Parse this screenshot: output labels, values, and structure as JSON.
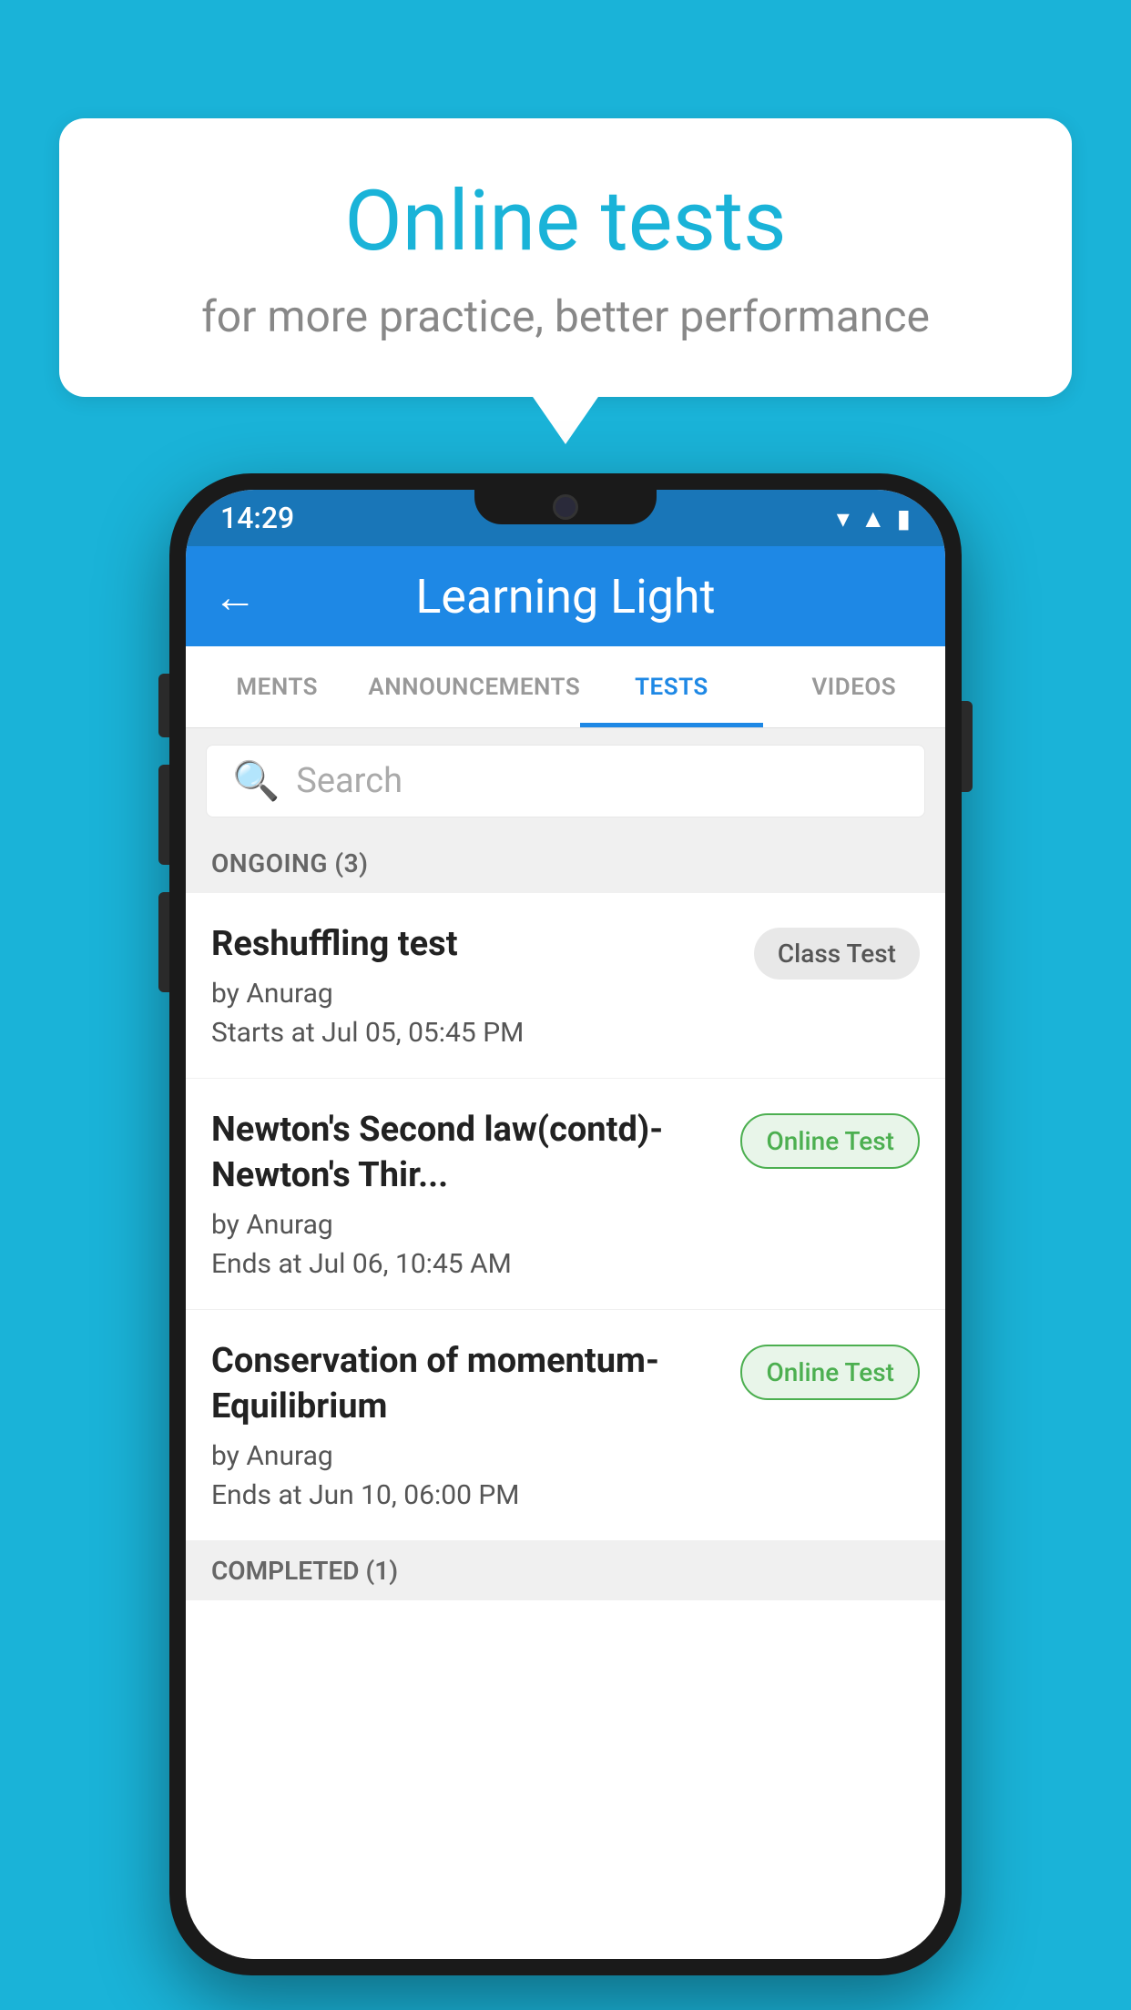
{
  "background_color": "#1ab3d8",
  "speech_bubble": {
    "title": "Online tests",
    "subtitle": "for more practice, better performance"
  },
  "phone": {
    "status_bar": {
      "time": "14:29",
      "icons": [
        "wifi",
        "signal",
        "battery"
      ]
    },
    "app_bar": {
      "title": "Learning Light",
      "back_label": "←"
    },
    "tabs": [
      {
        "label": "MENTS",
        "active": false
      },
      {
        "label": "ANNOUNCEMENTS",
        "active": false
      },
      {
        "label": "TESTS",
        "active": true
      },
      {
        "label": "VIDEOS",
        "active": false
      }
    ],
    "search": {
      "placeholder": "Search"
    },
    "sections": [
      {
        "label": "ONGOING (3)",
        "tests": [
          {
            "name": "Reshuffling test",
            "author": "by Anurag",
            "time_label": "Starts at",
            "time": "Jul 05, 05:45 PM",
            "badge": "Class Test",
            "badge_type": "class"
          },
          {
            "name": "Newton's Second law(contd)-Newton's Thir...",
            "author": "by Anurag",
            "time_label": "Ends at",
            "time": "Jul 06, 10:45 AM",
            "badge": "Online Test",
            "badge_type": "online"
          },
          {
            "name": "Conservation of momentum-Equilibrium",
            "author": "by Anurag",
            "time_label": "Ends at",
            "time": "Jun 10, 06:00 PM",
            "badge": "Online Test",
            "badge_type": "online"
          }
        ]
      }
    ],
    "completed_label": "COMPLETED (1)"
  }
}
